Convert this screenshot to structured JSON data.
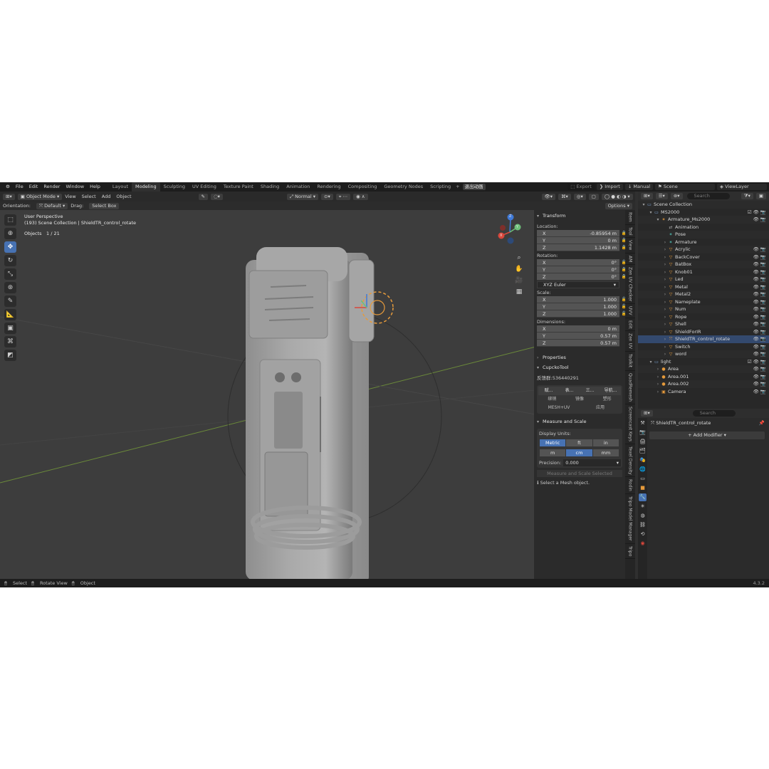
{
  "menu": [
    "File",
    "Edit",
    "Render",
    "Window",
    "Help"
  ],
  "workspaces": [
    "Layout",
    "Modeling",
    "Sculpting",
    "UV Editing",
    "Texture Paint",
    "Shading",
    "Animation",
    "Rendering",
    "Compositing",
    "Geometry Nodes",
    "Scripting"
  ],
  "active_workspace": "Modeling",
  "add_workspace": "+",
  "cn_tab": "退出动画",
  "topright": {
    "export": "Export",
    "import": "Import",
    "manual": "Manual",
    "scene": "Scene",
    "viewlayer": "ViewLayer"
  },
  "header": {
    "mode": "Object Mode",
    "menus": [
      "View",
      "Select",
      "Add",
      "Object"
    ],
    "pivot": "Normal",
    "orientation_label": "Orientation:",
    "orientation": "Default",
    "drag_label": "Drag:",
    "drag": "Select Box",
    "options": "Options"
  },
  "viewport": {
    "perspective": "User Perspective",
    "collection": "(193) Scene Collection | ShieldTR_control_rotate",
    "objects_label": "Objects",
    "objects_count": "1 / 21"
  },
  "gizmo": {
    "z": "Z",
    "y": "Y",
    "x": "X"
  },
  "transform": {
    "title": "Transform",
    "location_label": "Location:",
    "location": {
      "x": "-0.85954 m",
      "y": "0 m",
      "z": "1.1428 m"
    },
    "rotation_label": "Rotation:",
    "rotation": {
      "x": "0°",
      "y": "0°",
      "z": "0°"
    },
    "euler": "XYZ Euler",
    "scale_label": "Scale:",
    "scale": {
      "x": "1.000",
      "y": "1.000",
      "z": "1.000"
    },
    "dimensions_label": "Dimensions:",
    "dimensions": {
      "x": "0 m",
      "y": "0.57 m",
      "z": "0.57 m"
    }
  },
  "axes": {
    "x": "X",
    "y": "Y",
    "z": "Z"
  },
  "properties_title": "Properties",
  "cupcko": {
    "title": "CupckoTool",
    "feedback": "反馈群:536440291",
    "row1": [
      "赋...",
      "表...",
      "三...",
      "导航..."
    ],
    "row2": [
      "绑销",
      "镜像",
      "塑形"
    ],
    "row3": [
      "MESH+UV",
      "应用"
    ]
  },
  "measure": {
    "title": "Measure and Scale",
    "display_units_label": "Display Units:",
    "systems": [
      "Metric",
      "ft",
      "in"
    ],
    "units": [
      "m",
      "cm",
      "mm"
    ],
    "precision_label": "Precision:",
    "precision": "0.000",
    "button": "Measure and Scale Selected",
    "info": "Select a Mesh object."
  },
  "sidetabs": [
    "Item",
    "Tool",
    "View",
    "AM",
    "Zen UV Checker",
    "UVV",
    "Edit",
    "Zen UV",
    "Toolkit",
    "QuadRemesh",
    "Screencast Keys",
    "Texel Density",
    "Rodin",
    "Tripo Model Manager",
    "Tripo"
  ],
  "outliner": {
    "search_placeholder": "Search",
    "rows": [
      {
        "indent": 0,
        "label": "Scene Collection",
        "icon": "collection-icon",
        "right": ""
      },
      {
        "indent": 1,
        "label": "MS2000",
        "icon": "collection-icon",
        "right": "☑ 👁 📷"
      },
      {
        "indent": 2,
        "label": "Armature_Ms2000",
        "icon": "armature-icon",
        "right": "👁 📷"
      },
      {
        "indent": 3,
        "label": "Animation",
        "icon": "action-icon",
        "right": ""
      },
      {
        "indent": 3,
        "label": "Pose",
        "icon": "pose-icon",
        "right": ""
      },
      {
        "indent": 3,
        "label": "Armature",
        "icon": "bone-icon",
        "right": ""
      },
      {
        "indent": 3,
        "label": "Acrylic",
        "icon": "mesh-icon",
        "right": "👁 📷"
      },
      {
        "indent": 3,
        "label": "BackCover",
        "icon": "mesh-icon",
        "right": "👁 📷"
      },
      {
        "indent": 3,
        "label": "BatBox",
        "icon": "mesh-icon",
        "right": "👁 📷"
      },
      {
        "indent": 3,
        "label": "Knob01",
        "icon": "mesh-icon",
        "right": "👁 📷"
      },
      {
        "indent": 3,
        "label": "Led",
        "icon": "mesh-icon",
        "right": "👁 📷"
      },
      {
        "indent": 3,
        "label": "Metal",
        "icon": "mesh-icon",
        "right": "👁 📷"
      },
      {
        "indent": 3,
        "label": "Metal2",
        "icon": "mesh-icon",
        "right": "👁 📷"
      },
      {
        "indent": 3,
        "label": "Nameplate",
        "icon": "mesh-icon",
        "right": "👁 📷"
      },
      {
        "indent": 3,
        "label": "Num",
        "icon": "mesh-icon",
        "right": "👁 📷"
      },
      {
        "indent": 3,
        "label": "Rope",
        "icon": "mesh-icon",
        "right": "👁 📷"
      },
      {
        "indent": 3,
        "label": "Shell",
        "icon": "mesh-icon",
        "right": "👁 📷"
      },
      {
        "indent": 3,
        "label": "ShieldForIR",
        "icon": "mesh-icon",
        "right": "👁 📷"
      },
      {
        "indent": 3,
        "label": "ShieldTR_control_rotate",
        "icon": "empty-icon",
        "right": "👁 📷",
        "selected": true
      },
      {
        "indent": 3,
        "label": "Switch",
        "icon": "mesh-icon",
        "right": "👁 📷"
      },
      {
        "indent": 3,
        "label": "word",
        "icon": "mesh-icon",
        "right": "👁 📷"
      },
      {
        "indent": 1,
        "label": "light",
        "icon": "collection-icon",
        "right": "☑ 👁 📷"
      },
      {
        "indent": 2,
        "label": "Area",
        "icon": "light-icon",
        "right": "👁 📷"
      },
      {
        "indent": 2,
        "label": "Area.001",
        "icon": "light-icon",
        "right": "👁 📷"
      },
      {
        "indent": 2,
        "label": "Area.002",
        "icon": "light-icon",
        "right": "👁 📷"
      },
      {
        "indent": 2,
        "label": "Camera",
        "icon": "camera-icon",
        "right": "👁 📷"
      }
    ]
  },
  "props": {
    "search_placeholder": "Search",
    "object_name": "ShieldTR_control_rotate",
    "add_modifier": "Add Modifier"
  },
  "statusbar": {
    "select": "Select",
    "rotate": "Rotate View",
    "object": "Object",
    "version": "4.3.2"
  }
}
